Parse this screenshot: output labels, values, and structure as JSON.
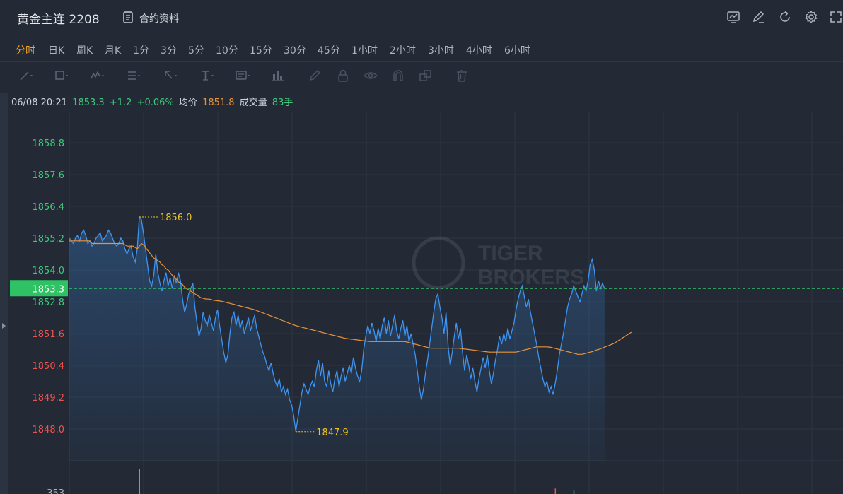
{
  "header": {
    "title": "黄金主连 2208",
    "contract_label": "合约资料",
    "icons": [
      "chart-icon",
      "edit-icon",
      "refresh-icon",
      "settings-icon",
      "fullscreen-icon"
    ]
  },
  "periods": [
    "分时",
    "日K",
    "周K",
    "月K",
    "1分",
    "3分",
    "5分",
    "10分",
    "15分",
    "30分",
    "45分",
    "1小时",
    "2小时",
    "3小时",
    "4小时",
    "6小时"
  ],
  "active_period": "分时",
  "drawing_tools": [
    "line-tool-icon",
    "rect-tool-icon",
    "wave-tool-icon",
    "fib-tool-icon",
    "arrow-tool-icon",
    "text-tool-icon",
    "label-tool-icon",
    "measure-tool-icon",
    "pencil-icon",
    "lock-icon",
    "eye-icon",
    "magnet-icon",
    "clone-icon",
    "trash-icon"
  ],
  "info": {
    "datetime": "06/08 20:21",
    "price": "1853.3",
    "change": "+1.2",
    "change_pct": "+0.06%",
    "avg_label": "均价",
    "avg_value": "1851.8",
    "volume_label": "成交量",
    "volume_value": "83手"
  },
  "watermark": {
    "line1": "TIGER",
    "line2": "BROKERS"
  },
  "colors": {
    "up": "#3ec97a",
    "down": "#ef5350",
    "price_line": "#3d94f2",
    "avg_line": "#e8923a",
    "current": "#2ec264",
    "marker": "#f0c419"
  },
  "chart_data": {
    "type": "line",
    "ylim": [
      1847.6,
      1859.6
    ],
    "yticks": [
      {
        "value": 1858.8,
        "label": "1858.8",
        "dir": "up"
      },
      {
        "value": 1857.6,
        "label": "1857.6",
        "dir": "up"
      },
      {
        "value": 1856.4,
        "label": "1856.4",
        "dir": "up"
      },
      {
        "value": 1855.2,
        "label": "1855.2",
        "dir": "up"
      },
      {
        "value": 1854.0,
        "label": "1854.0",
        "dir": "up"
      },
      {
        "value": 1852.8,
        "label": "1852.8",
        "dir": "up"
      },
      {
        "value": 1851.6,
        "label": "1851.6",
        "dir": "down"
      },
      {
        "value": 1850.4,
        "label": "1850.4",
        "dir": "down"
      },
      {
        "value": 1849.2,
        "label": "1849.2",
        "dir": "down"
      },
      {
        "value": 1848.0,
        "label": "1848.0",
        "dir": "down"
      }
    ],
    "current_price": {
      "value": 1853.3,
      "label": "1853.3"
    },
    "max_marker": {
      "index": 34,
      "value": 1856.0,
      "label": "1856.0"
    },
    "min_marker": {
      "index": 110,
      "value": 1847.9,
      "label": "1847.9"
    },
    "total_points": 260,
    "series": [
      {
        "type": "price",
        "values": [
          1855.2,
          1855.1,
          1855.0,
          1855.2,
          1855.3,
          1855.1,
          1855.4,
          1855.5,
          1855.3,
          1855.0,
          1855.1,
          1854.9,
          1855.0,
          1855.2,
          1855.3,
          1855.4,
          1855.1,
          1855.2,
          1855.3,
          1855.5,
          1855.4,
          1855.2,
          1855.0,
          1854.9,
          1855.0,
          1855.2,
          1855.1,
          1854.8,
          1854.6,
          1854.8,
          1854.9,
          1854.5,
          1854.3,
          1854.8,
          1856.0,
          1855.9,
          1855.4,
          1854.8,
          1854.2,
          1853.6,
          1853.4,
          1853.8,
          1854.6,
          1853.9,
          1853.5,
          1853.2,
          1853.6,
          1853.9,
          1853.4,
          1853.7,
          1853.3,
          1853.8,
          1853.5,
          1853.9,
          1853.6,
          1852.9,
          1852.4,
          1852.7,
          1853.1,
          1853.3,
          1853.5,
          1852.6,
          1852.0,
          1851.5,
          1851.8,
          1852.4,
          1852.1,
          1851.9,
          1852.3,
          1852.0,
          1851.7,
          1852.2,
          1852.5,
          1851.9,
          1851.4,
          1850.9,
          1850.5,
          1850.8,
          1851.6,
          1852.2,
          1852.4,
          1851.9,
          1852.3,
          1851.8,
          1852.1,
          1851.6,
          1851.9,
          1852.2,
          1851.7,
          1852.0,
          1852.3,
          1851.8,
          1851.5,
          1851.2,
          1850.9,
          1850.7,
          1850.4,
          1850.2,
          1850.5,
          1850.1,
          1849.8,
          1849.6,
          1849.9,
          1849.4,
          1849.6,
          1849.3,
          1849.5,
          1849.1,
          1848.9,
          1848.5,
          1847.9,
          1848.4,
          1848.9,
          1849.4,
          1849.7,
          1849.5,
          1849.3,
          1849.6,
          1849.8,
          1849.6,
          1850.2,
          1850.6,
          1850.0,
          1850.5,
          1849.8,
          1849.6,
          1850.2,
          1849.7,
          1849.4,
          1849.9,
          1850.2,
          1849.6,
          1850.0,
          1850.3,
          1849.8,
          1850.1,
          1850.4,
          1850.1,
          1850.7,
          1850.3,
          1850.0,
          1849.8,
          1850.2,
          1851.0,
          1851.5,
          1851.9,
          1851.6,
          1852.0,
          1851.7,
          1851.3,
          1851.8,
          1851.4,
          1851.9,
          1852.2,
          1851.6,
          1852.1,
          1851.5,
          1851.9,
          1852.3,
          1851.7,
          1851.4,
          1851.8,
          1852.1,
          1851.5,
          1851.9,
          1851.3,
          1851.6,
          1851.2,
          1850.8,
          1850.2,
          1849.6,
          1849.1,
          1849.5,
          1850.1,
          1850.6,
          1851.2,
          1851.8,
          1852.4,
          1852.9,
          1853.1,
          1852.6,
          1852.2,
          1851.6,
          1852.4,
          1851.1,
          1850.4,
          1850.9,
          1851.5,
          1852.0,
          1851.4,
          1851.8,
          1850.9,
          1850.2,
          1850.8,
          1850.4,
          1849.9,
          1850.3,
          1849.8,
          1849.4,
          1849.9,
          1850.3,
          1850.7,
          1850.3,
          1850.8,
          1850.2,
          1849.7,
          1850.1,
          1850.6,
          1851.0,
          1851.5,
          1851.2,
          1851.6,
          1851.3,
          1851.8,
          1851.4,
          1851.7,
          1852.0,
          1852.5,
          1852.9,
          1853.2,
          1853.4,
          1853.0,
          1852.6,
          1852.9,
          1852.4,
          1852.0,
          1851.6,
          1851.2,
          1850.7,
          1850.3,
          1849.9,
          1849.6,
          1849.8,
          1849.4,
          1849.6,
          1849.3,
          1849.7,
          1850.2,
          1850.8,
          1851.2,
          1851.6,
          1852.1,
          1852.6,
          1852.9,
          1853.1,
          1853.4,
          1853.2,
          1853.0,
          1852.8,
          1853.1,
          1853.4,
          1853.2,
          1853.6,
          1854.2,
          1854.4,
          1854.0,
          1853.2,
          1853.6,
          1853.3,
          1853.5,
          1853.3
        ],
        "fill": true
      },
      {
        "type": "average",
        "values": [
          1855.1,
          1855.1,
          1855.1,
          1855.1,
          1855.1,
          1855.1,
          1855.1,
          1855.1,
          1855.1,
          1855.1,
          1855.1,
          1855.0,
          1855.0,
          1855.0,
          1855.0,
          1855.0,
          1855.0,
          1855.0,
          1855.0,
          1855.0,
          1855.0,
          1855.0,
          1855.0,
          1855.0,
          1855.0,
          1855.0,
          1855.0,
          1854.95,
          1854.9,
          1854.9,
          1854.9,
          1854.9,
          1854.85,
          1854.8,
          1854.9,
          1855.0,
          1854.95,
          1854.85,
          1854.75,
          1854.65,
          1854.55,
          1854.45,
          1854.4,
          1854.35,
          1854.3,
          1854.2,
          1854.15,
          1854.05,
          1854.0,
          1853.9,
          1853.8,
          1853.75,
          1853.65,
          1853.55,
          1853.5,
          1853.45,
          1853.35,
          1853.3,
          1853.25,
          1853.2,
          1853.15,
          1853.1,
          1853.05,
          1853.0,
          1852.95,
          1852.93,
          1852.91,
          1852.9,
          1852.9,
          1852.88,
          1852.86,
          1852.85,
          1852.84,
          1852.83,
          1852.82,
          1852.8,
          1852.78,
          1852.76,
          1852.74,
          1852.72,
          1852.7,
          1852.68,
          1852.66,
          1852.64,
          1852.62,
          1852.6,
          1852.58,
          1852.56,
          1852.54,
          1852.52,
          1852.5,
          1852.47,
          1852.44,
          1852.41,
          1852.38,
          1852.35,
          1852.32,
          1852.29,
          1852.26,
          1852.23,
          1852.2,
          1852.17,
          1852.14,
          1852.11,
          1852.08,
          1852.05,
          1852.02,
          1851.99,
          1851.96,
          1851.93,
          1851.9,
          1851.88,
          1851.86,
          1851.84,
          1851.82,
          1851.8,
          1851.78,
          1851.76,
          1851.74,
          1851.72,
          1851.7,
          1851.68,
          1851.66,
          1851.64,
          1851.62,
          1851.6,
          1851.58,
          1851.56,
          1851.54,
          1851.52,
          1851.5,
          1851.48,
          1851.46,
          1851.44,
          1851.42,
          1851.41,
          1851.4,
          1851.39,
          1851.38,
          1851.37,
          1851.36,
          1851.35,
          1851.34,
          1851.33,
          1851.32,
          1851.31,
          1851.3,
          1851.3,
          1851.3,
          1851.3,
          1851.3,
          1851.3,
          1851.3,
          1851.3,
          1851.3,
          1851.3,
          1851.3,
          1851.3,
          1851.3,
          1851.3,
          1851.3,
          1851.3,
          1851.3,
          1851.3,
          1851.28,
          1851.26,
          1851.24,
          1851.22,
          1851.2,
          1851.18,
          1851.16,
          1851.14,
          1851.12,
          1851.1,
          1851.08,
          1851.06,
          1851.05,
          1851.05,
          1851.05,
          1851.05,
          1851.05,
          1851.05,
          1851.05,
          1851.05,
          1851.05,
          1851.05,
          1851.05,
          1851.05,
          1851.05,
          1851.05,
          1851.04,
          1851.03,
          1851.02,
          1851.01,
          1851.0,
          1850.99,
          1850.98,
          1850.97,
          1850.96,
          1850.95,
          1850.94,
          1850.93,
          1850.92,
          1850.91,
          1850.9,
          1850.9,
          1850.9,
          1850.9,
          1850.9,
          1850.9,
          1850.9,
          1850.9,
          1850.9,
          1850.9,
          1850.9,
          1850.9,
          1850.9,
          1850.9,
          1850.92,
          1850.94,
          1850.96,
          1850.98,
          1851.0,
          1851.02,
          1851.04,
          1851.06,
          1851.08,
          1851.1,
          1851.1,
          1851.1,
          1851.1,
          1851.1,
          1851.1,
          1851.09,
          1851.08,
          1851.06,
          1851.04,
          1851.02,
          1851.0,
          1850.98,
          1850.96,
          1850.94,
          1850.92,
          1850.9,
          1850.88,
          1850.86,
          1850.84,
          1850.82,
          1850.82,
          1850.82,
          1850.84,
          1850.86,
          1850.88,
          1850.9,
          1850.92,
          1850.95,
          1850.98,
          1851.0,
          1851.03,
          1851.06,
          1851.09,
          1851.12,
          1851.15,
          1851.18,
          1851.21,
          1851.25,
          1851.3,
          1851.35,
          1851.4,
          1851.45,
          1851.5,
          1851.55,
          1851.6,
          1851.65
        ]
      }
    ],
    "volume": {
      "bars": [
        {
          "index": 34,
          "value": 353,
          "dir": "up"
        },
        {
          "index": 236,
          "value": 75,
          "dir": "down"
        },
        {
          "index": 245,
          "value": 45,
          "dir": "up"
        }
      ],
      "ymax": 353,
      "tick_label": "353"
    }
  }
}
